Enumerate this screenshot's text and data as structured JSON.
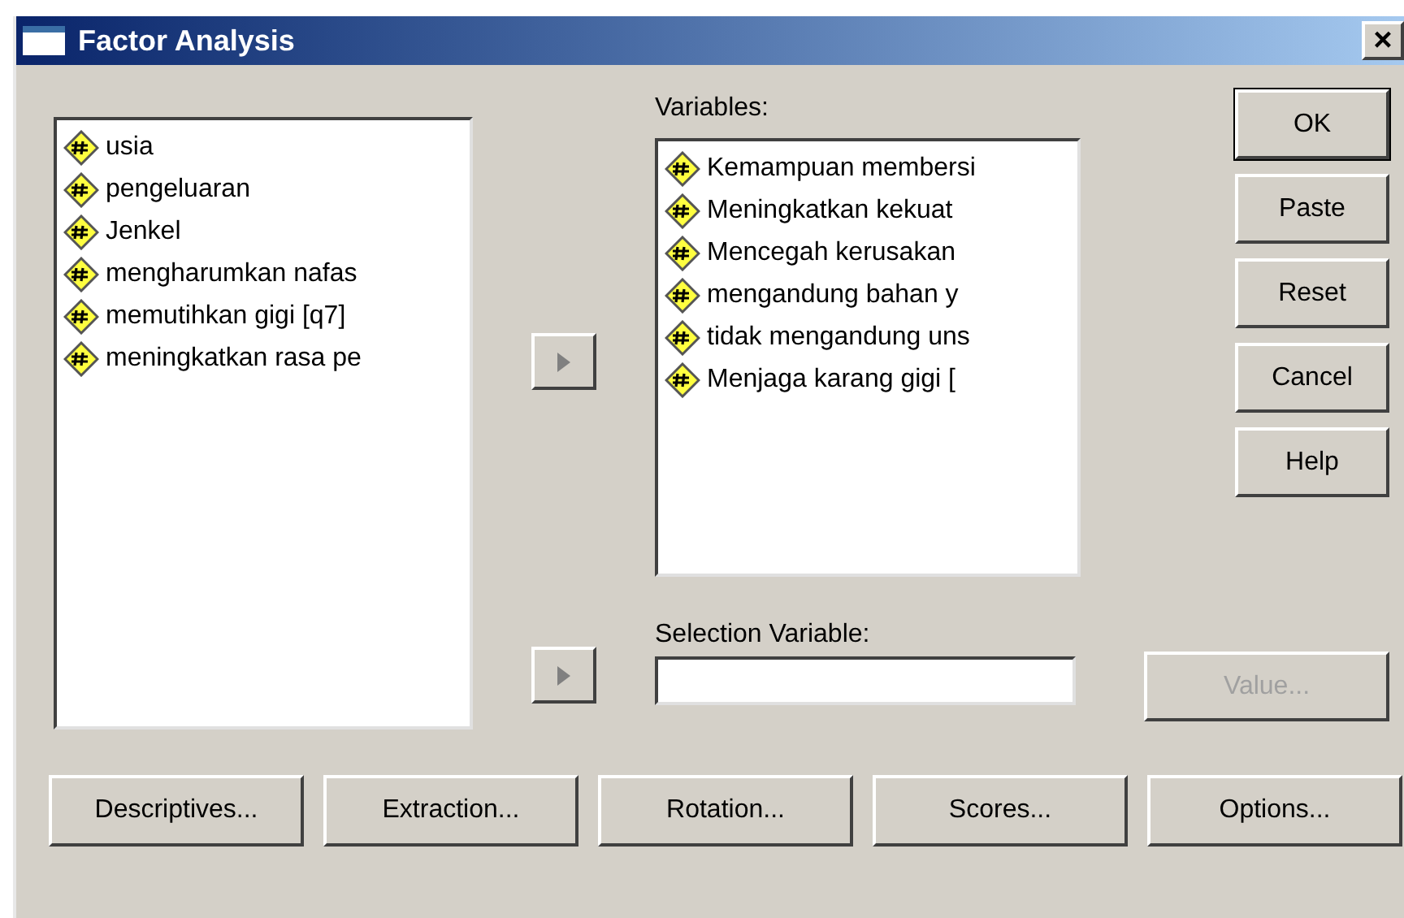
{
  "window": {
    "title": "Factor Analysis",
    "close": "×"
  },
  "source_list": {
    "items": [
      {
        "label": "usia",
        "selected": false
      },
      {
        "label": "pengeluaran",
        "selected": false
      },
      {
        "label": "Jenkel",
        "selected": false
      },
      {
        "label": "mengharumkan nafas",
        "selected": false
      },
      {
        "label": "memutihkan gigi [q7]",
        "selected": false
      },
      {
        "label": "meningkatkan rasa pe",
        "selected": false
      }
    ]
  },
  "variables": {
    "label": "Variables:",
    "items": [
      {
        "label": "Kemampuan membersi",
        "selected": false
      },
      {
        "label": "Meningkatkan kekuat",
        "selected": false
      },
      {
        "label": "Mencegah kerusakan",
        "selected": false
      },
      {
        "label": "mengandung bahan y",
        "selected": false
      },
      {
        "label": "tidak mengandung uns",
        "selected": false
      },
      {
        "label": "Menjaga karang gigi [",
        "selected": false
      }
    ],
    "move_button": {
      "disabled": true
    }
  },
  "selection_variable": {
    "label": "Selection Variable:",
    "move_button": {
      "disabled": true
    },
    "value_button": {
      "label": "Value...",
      "disabled": true
    }
  },
  "side_buttons": [
    {
      "label": "OK",
      "default": true
    },
    {
      "label": "Paste",
      "default": false
    },
    {
      "label": "Reset",
      "default": false
    },
    {
      "label": "Cancel",
      "default": false
    },
    {
      "label": "Help",
      "default": false
    }
  ],
  "bottom_buttons": [
    "Descriptives...",
    "Extraction...",
    "Rotation...",
    "Scores...",
    "Options..."
  ]
}
